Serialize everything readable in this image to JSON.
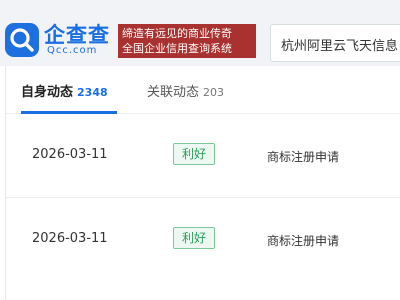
{
  "header": {
    "logo_text": "企查查",
    "logo_subtext": "Qcc.com",
    "slogan_line1": "缔造有远见的商业传奇",
    "slogan_line2": "全国企业信用查询系统",
    "search_value": "杭州阿里云飞天信息",
    "colors": {
      "brand": "#1a6fe3",
      "slogan_bg": "#a9312f"
    }
  },
  "tabs": [
    {
      "label": "自身动态",
      "count": "2348",
      "active": true
    },
    {
      "label": "关联动态",
      "count": "203",
      "active": false
    }
  ],
  "rows": [
    {
      "date": "2026-03-11",
      "badge": "利好",
      "type": "商标注册申请"
    },
    {
      "date": "2026-03-11",
      "badge": "利好",
      "type": "商标注册申请"
    }
  ],
  "colors": {
    "badge_green": "#27a05a",
    "active_tab": "#1a6fe3"
  }
}
